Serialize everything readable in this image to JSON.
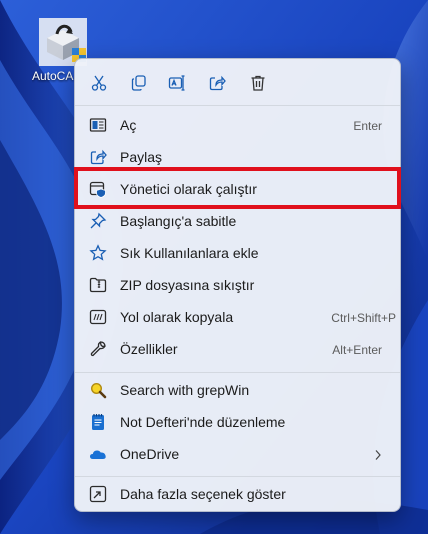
{
  "desktop": {
    "shortcut_label": "AutoCA",
    "shortcut_icon": "autocad-installer-icon"
  },
  "context_menu": {
    "toolbar": [
      {
        "name": "cut-icon",
        "tooltip": ""
      },
      {
        "name": "copy-icon",
        "tooltip": ""
      },
      {
        "name": "rename-icon",
        "tooltip": ""
      },
      {
        "name": "share-icon",
        "tooltip": ""
      },
      {
        "name": "delete-icon",
        "tooltip": ""
      }
    ],
    "items": [
      {
        "label": "Aç",
        "shortcut": "Enter",
        "icon": "open-icon"
      },
      {
        "label": "Paylaş",
        "shortcut": "",
        "icon": "share-icon"
      },
      {
        "label": "Yönetici olarak çalıştır",
        "shortcut": "",
        "icon": "run-as-admin-shield-icon"
      },
      {
        "label": "Başlangıç'a sabitle",
        "shortcut": "",
        "icon": "pin-icon"
      },
      {
        "label": "Sık Kullanılanlara ekle",
        "shortcut": "",
        "icon": "star-icon"
      },
      {
        "label": "ZIP dosyasına sıkıştır",
        "shortcut": "",
        "icon": "zip-folder-icon"
      },
      {
        "label": "Yol olarak kopyala",
        "shortcut": "Ctrl+Shift+P",
        "icon": "copy-path-icon"
      },
      {
        "label": "Özellikler",
        "shortcut": "Alt+Enter",
        "icon": "wrench-icon"
      },
      {
        "label": "Search with grepWin",
        "shortcut": "",
        "icon": "grepwin-search-icon"
      },
      {
        "label": "Not Defteri'nde düzenleme",
        "shortcut": "",
        "icon": "notepad-icon"
      },
      {
        "label": "OneDrive",
        "shortcut": "",
        "icon": "onedrive-cloud-icon",
        "submenu": true
      },
      {
        "label": "Daha fazla seçenek göster",
        "shortcut": "",
        "icon": "show-more-options-icon"
      }
    ]
  },
  "colors": {
    "accent": "#0067c0",
    "highlight_border": "#e0101c",
    "menu_bg": "#eef2f8"
  }
}
